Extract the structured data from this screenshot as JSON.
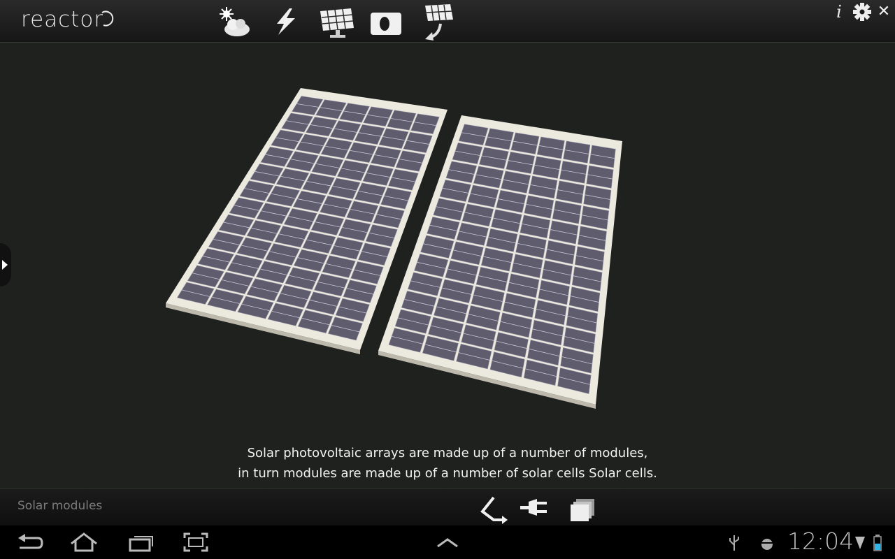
{
  "app": {
    "logo_text": "reactor"
  },
  "toolbar": {
    "items": [
      {
        "icon": "sun-cloud-icon"
      },
      {
        "icon": "lightning-icon"
      },
      {
        "icon": "solar-panel-icon"
      },
      {
        "icon": "camera-icon"
      },
      {
        "icon": "solar-panel-rotate-icon"
      }
    ],
    "info_icon_glyph": "i",
    "settings_icon": "gear-icon",
    "close_glyph": "✕"
  },
  "scene": {
    "panel_color": "#5f5c6e",
    "frame_color": "#ece9df",
    "background": "#1f211f"
  },
  "caption": {
    "line1": "Solar photovoltaic arrays are made up of a number of modules,",
    "line2": "in turn modules are made up of a number of solar cells Solar cells."
  },
  "bottom_bar": {
    "section_title": "Solar modules",
    "icons": [
      "back-arrow-icon",
      "plug-icon",
      "layers-icon"
    ]
  },
  "system_bar": {
    "time": "12:04",
    "status_icons": [
      "usb-icon",
      "android-debug-icon",
      "wifi-icon",
      "battery-icon"
    ]
  }
}
